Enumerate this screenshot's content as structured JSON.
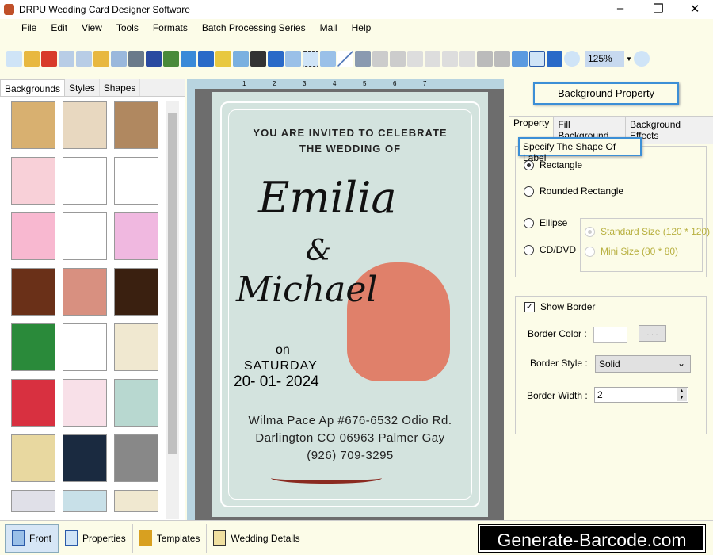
{
  "window": {
    "title": "DRPU Wedding Card Designer Software"
  },
  "menu": [
    "File",
    "Edit",
    "View",
    "Tools",
    "Formats",
    "Batch Processing Series",
    "Mail",
    "Help"
  ],
  "toolbar": {
    "zoom": "125%"
  },
  "left_tabs": [
    "Backgrounds",
    "Styles",
    "Shapes"
  ],
  "ruler_labels": [
    "1",
    "2",
    "3",
    "4",
    "5",
    "6",
    "7"
  ],
  "card": {
    "invite_line1": "YOU ARE INVITED TO CELEBRATE",
    "invite_line2": "THE WEDDING OF",
    "name1": "Emilia",
    "amp": "&",
    "name2": "Michael",
    "on": "on",
    "day": "SATURDAY",
    "date": "20- 01- 2024",
    "address1": "Wilma Pace Ap #676-6532 Odio Rd.",
    "address2": "Darlington CO 06963 Palmer Gay",
    "phone": "(926) 709-3295"
  },
  "right": {
    "title": "Background Property",
    "tabs": [
      "Property",
      "Fill Background",
      "Background Effects"
    ],
    "shape_group": "Specify The Shape Of Label",
    "shapes": [
      {
        "label": "Rectangle",
        "selected": true
      },
      {
        "label": "Rounded Rectangle",
        "selected": false
      },
      {
        "label": "Ellipse",
        "selected": false
      },
      {
        "label": "CD/DVD",
        "selected": false
      }
    ],
    "sizes": [
      {
        "label": "Standard Size (120 * 120)",
        "selected": true
      },
      {
        "label": "Mini Size (80 * 80)",
        "selected": false
      }
    ],
    "show_border": "Show Border",
    "show_border_checked": true,
    "border_color_label": "Border Color :",
    "browse": ". . .",
    "border_style_label": "Border Style :",
    "border_style": "Solid",
    "border_width_label": "Border Width :",
    "border_width": "2"
  },
  "bottom": {
    "tabs": [
      "Front",
      "Properties",
      "Templates",
      "Wedding Details"
    ],
    "brand": "Generate-Barcode.com"
  }
}
